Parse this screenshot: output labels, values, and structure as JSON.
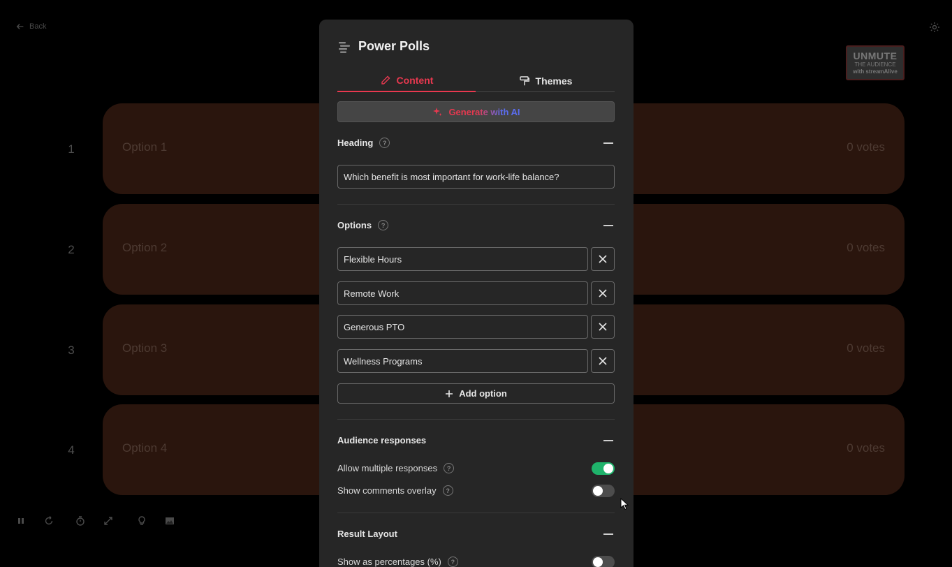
{
  "topbar": {
    "back_label": "Back",
    "gear_icon": "gear-icon"
  },
  "logo": {
    "line1": "UNMUTE",
    "line2": "THE AUDIENCE",
    "line3": "with streamAlive"
  },
  "poll_rows": [
    {
      "number": "1",
      "label": "Option 1",
      "votes": "0 votes"
    },
    {
      "number": "2",
      "label": "Option 2",
      "votes": "0 votes"
    },
    {
      "number": "3",
      "label": "Option 3",
      "votes": "0 votes"
    },
    {
      "number": "4",
      "label": "Option 4",
      "votes": "0 votes"
    }
  ],
  "controls": [
    "pause-icon",
    "refresh-icon",
    "timer-icon",
    "expand-icon",
    "lightbulb-icon",
    "image-icon"
  ],
  "panel": {
    "title": "Power Polls",
    "tabs": [
      {
        "label": "Content"
      },
      {
        "label": "Themes"
      }
    ],
    "generate_label": "Generate with AI",
    "heading": {
      "title": "Heading",
      "value": "Which benefit is most important for work-life balance?"
    },
    "options": {
      "title": "Options",
      "items": [
        {
          "value": "Flexible Hours"
        },
        {
          "value": "Remote Work"
        },
        {
          "value": "Generous PTO"
        },
        {
          "value": "Wellness Programs"
        }
      ],
      "add_label": "Add option"
    },
    "audience": {
      "title": "Audience responses",
      "allow_multiple": {
        "label": "Allow multiple responses",
        "on": true
      },
      "show_comments": {
        "label": "Show comments overlay",
        "on": false
      }
    },
    "result_layout": {
      "title": "Result Layout",
      "show_percentages": {
        "label": "Show as percentages (%)",
        "on": false
      }
    }
  },
  "colors": {
    "accent": "#e8384f",
    "toggle_on": "#1fb36b",
    "ai_blue": "#5b6df0",
    "row_bg": "#2a150d"
  }
}
